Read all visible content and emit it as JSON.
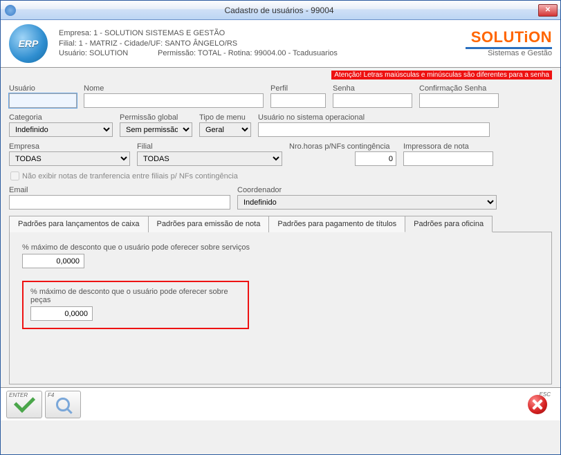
{
  "window": {
    "title": "Cadastro de usuários - 99004"
  },
  "header": {
    "line1": "Empresa: 1 - SOLUTION SISTEMAS E GESTÃO",
    "line2": "Filial: 1 - MATRIZ - Cidade/UF: SANTO ÂNGELO/RS",
    "line3a": "Usuário: SOLUTION",
    "line3b": "Permissão: TOTAL - Rotina: 99004.00 - Tcadusuarios",
    "brand": "SOLUT",
    "brand_accent": "i",
    "brand_tail": "ON",
    "brand_sub": "Sistemas e Gestão",
    "erp": "ERP"
  },
  "warning": "Atenção! Letras maiúsculas e minúsculas são diferentes para a senha",
  "labels": {
    "usuario": "Usuário",
    "nome": "Nome",
    "perfil": "Perfil",
    "senha": "Senha",
    "confirma": "Confirmação Senha",
    "categoria": "Categoria",
    "perm_global": "Permissão global",
    "tipo_menu": "Tipo de menu",
    "user_so": "Usuário no sistema operacional",
    "empresa": "Empresa",
    "filial": "Filial",
    "nro_horas": "Nro.horas p/NFs contingência",
    "impressora": "Impressora de nota",
    "chk_notas": "Não exibir notas de tranferencia entre filiais p/ NFs contingência",
    "email": "Email",
    "coord": "Coordenador"
  },
  "values": {
    "categoria": "Indefinido",
    "perm_global": "Sem permissão",
    "tipo_menu": "Geral",
    "empresa": "TODAS",
    "filial": "TODAS",
    "nro_horas": "0",
    "coord": "Indefinido"
  },
  "tabs": {
    "t1": "Padrões para lançamentos de caixa",
    "t2": "Padrões para emissão de nota",
    "t3": "Padrões para pagamento de títulos",
    "t4": "Padrões para oficina"
  },
  "tab4": {
    "label_servicos": "% máximo de desconto que o usuário pode oferecer sobre serviços",
    "val_servicos": "0,0000",
    "label_pecas": "% máximo de desconto que o usuário pode oferecer sobre peças",
    "val_pecas": "0,0000"
  },
  "footer": {
    "enter": "ENTER",
    "f4": "F4",
    "esc": "ESC"
  }
}
